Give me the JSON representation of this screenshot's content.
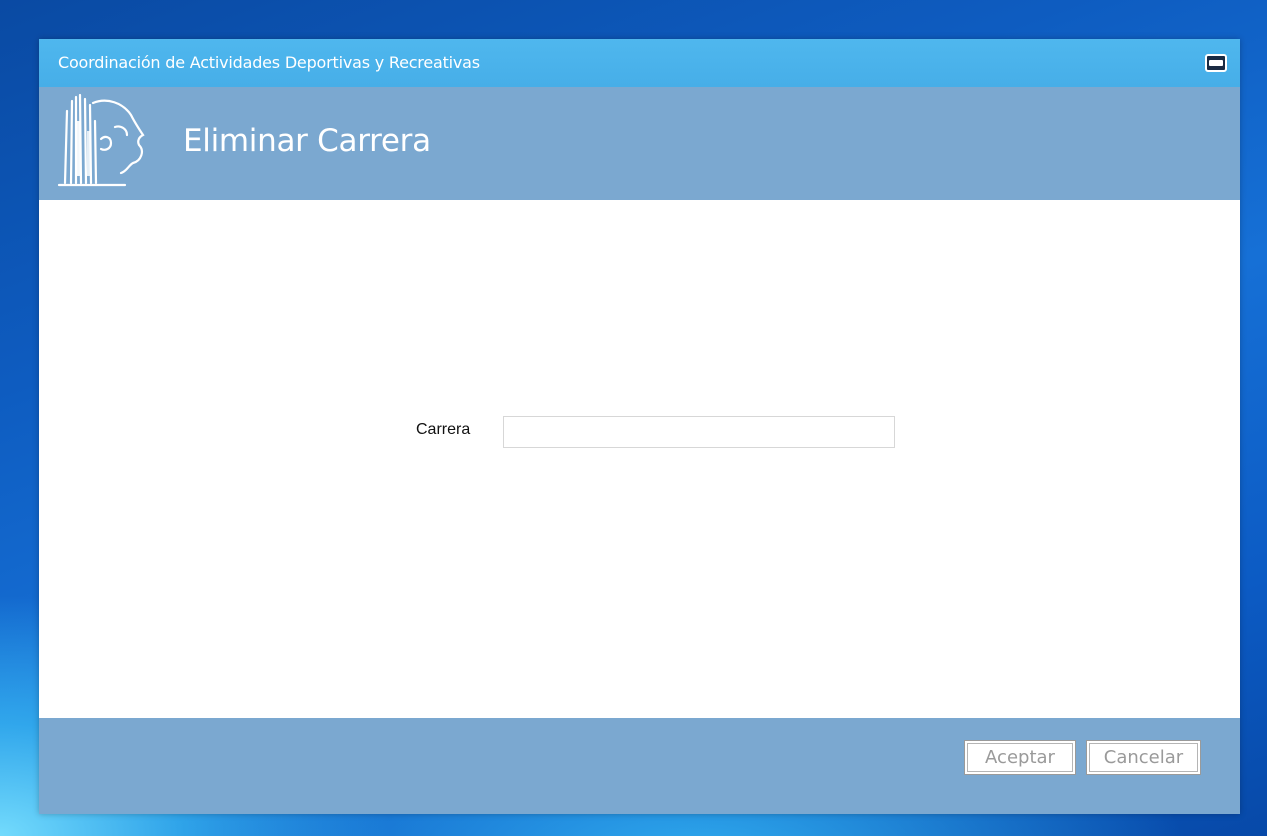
{
  "window": {
    "title": "Coordinación de Actividades Deportivas y Recreativas"
  },
  "header": {
    "heading": "Eliminar Carrera",
    "logo_icon": "university-building-lion-logo"
  },
  "form": {
    "carrera_label": "Carrera",
    "carrera_value": "",
    "carrera_placeholder": ""
  },
  "footer": {
    "accept_label": "Aceptar",
    "cancel_label": "Cancelar"
  },
  "colors": {
    "titlebar": "#4fb7ee",
    "header_footer": "#7ba8d0",
    "button_text_disabled": "#9a9a9a"
  }
}
